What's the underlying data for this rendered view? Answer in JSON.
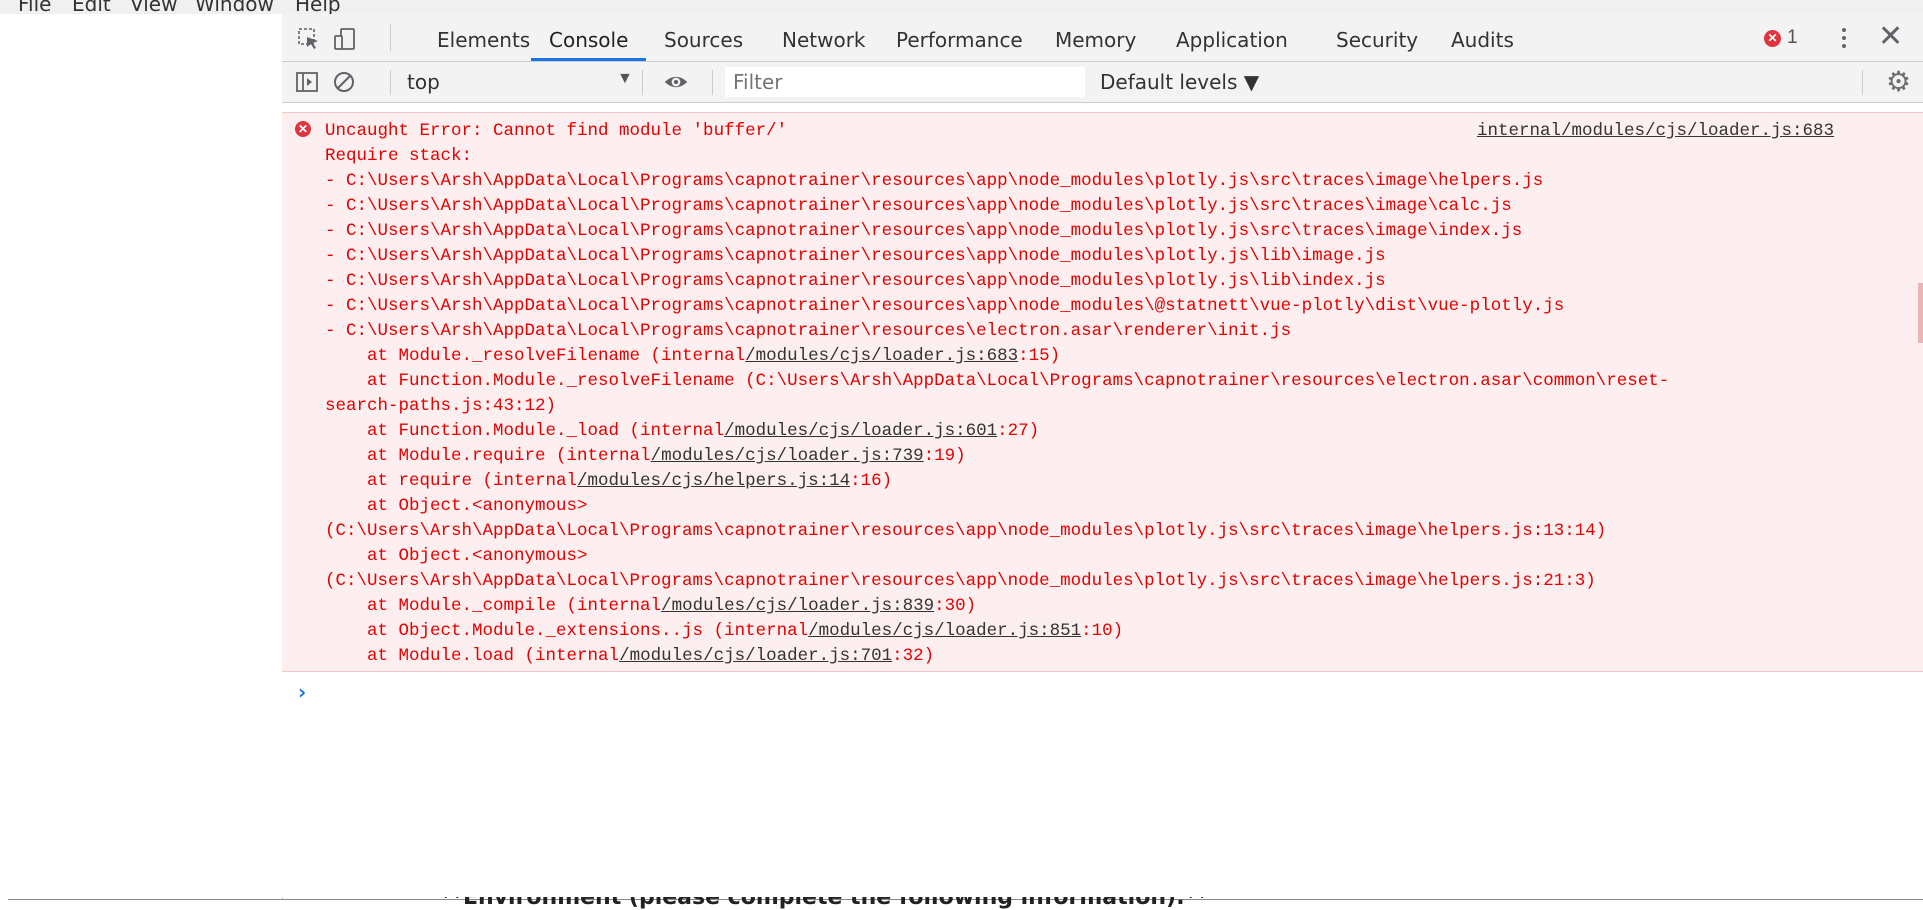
{
  "app_menu": [
    "File",
    "Edit",
    "View",
    "Window",
    "Help"
  ],
  "background_text": "**Environment (please complete the following information):**",
  "devtools": {
    "tabs": [
      "Elements",
      "Console",
      "Sources",
      "Network",
      "Performance",
      "Memory",
      "Application",
      "Security",
      "Audits"
    ],
    "active_tab": "Console",
    "error_count": "1",
    "icons": {
      "inspect": "inspect-element-icon",
      "device": "device-toolbar-icon",
      "menu": "kebab-menu-icon",
      "close": "close-icon",
      "sidebar": "console-sidebar-icon",
      "clear": "clear-console-icon",
      "eye": "live-expression-icon",
      "settings": "gear-icon"
    }
  },
  "console": {
    "context": "top",
    "filter_placeholder": "Filter",
    "levels": "Default levels",
    "accent_color": "#1a73e8",
    "error_color": "#e60000",
    "error_bg": "#fdefef",
    "error": {
      "source_link": "internal/modules/cjs/loader.js:683",
      "lines": [
        [
          {
            "t": "Uncaught Error: Cannot find module 'buffer/'"
          }
        ],
        [
          {
            "t": "Require stack:"
          }
        ],
        [
          {
            "t": "- C:\\Users\\Arsh\\AppData\\Local\\Programs\\capnotrainer\\resources\\app\\node_modules\\plotly.js\\src\\traces\\image\\helpers.js"
          }
        ],
        [
          {
            "t": "- C:\\Users\\Arsh\\AppData\\Local\\Programs\\capnotrainer\\resources\\app\\node_modules\\plotly.js\\src\\traces\\image\\calc.js"
          }
        ],
        [
          {
            "t": "- C:\\Users\\Arsh\\AppData\\Local\\Programs\\capnotrainer\\resources\\app\\node_modules\\plotly.js\\src\\traces\\image\\index.js"
          }
        ],
        [
          {
            "t": "- C:\\Users\\Arsh\\AppData\\Local\\Programs\\capnotrainer\\resources\\app\\node_modules\\plotly.js\\lib\\image.js"
          }
        ],
        [
          {
            "t": "- C:\\Users\\Arsh\\AppData\\Local\\Programs\\capnotrainer\\resources\\app\\node_modules\\plotly.js\\lib\\index.js"
          }
        ],
        [
          {
            "t": "- C:\\Users\\Arsh\\AppData\\Local\\Programs\\capnotrainer\\resources\\app\\node_modules\\@statnett\\vue-plotly\\dist\\vue-plotly.js"
          }
        ],
        [
          {
            "t": "- C:\\Users\\Arsh\\AppData\\Local\\Programs\\capnotrainer\\resources\\electron.asar\\renderer\\init.js"
          }
        ],
        [
          {
            "t": "    at Module._resolveFilename (internal"
          },
          {
            "t": "/modules/cjs/loader.js:683",
            "link": true
          },
          {
            "t": ":15)"
          }
        ],
        [
          {
            "t": "    at Function.Module._resolveFilename (C:\\Users\\Arsh\\AppData\\Local\\Programs\\capnotrainer\\resources\\electron.asar\\common\\reset-"
          }
        ],
        [
          {
            "t": "search-paths.js:43:12)"
          }
        ],
        [
          {
            "t": "    at Function.Module._load (internal"
          },
          {
            "t": "/modules/cjs/loader.js:601",
            "link": true
          },
          {
            "t": ":27)"
          }
        ],
        [
          {
            "t": "    at Module.require (internal"
          },
          {
            "t": "/modules/cjs/loader.js:739",
            "link": true
          },
          {
            "t": ":19)"
          }
        ],
        [
          {
            "t": "    at require (internal"
          },
          {
            "t": "/modules/cjs/helpers.js:14",
            "link": true
          },
          {
            "t": ":16)"
          }
        ],
        [
          {
            "t": "    at Object.<anonymous>"
          }
        ],
        [
          {
            "t": "(C:\\Users\\Arsh\\AppData\\Local\\Programs\\capnotrainer\\resources\\app\\node_modules\\plotly.js\\src\\traces\\image\\helpers.js:13:14)"
          }
        ],
        [
          {
            "t": "    at Object.<anonymous>"
          }
        ],
        [
          {
            "t": "(C:\\Users\\Arsh\\AppData\\Local\\Programs\\capnotrainer\\resources\\app\\node_modules\\plotly.js\\src\\traces\\image\\helpers.js:21:3)"
          }
        ],
        [
          {
            "t": "    at Module._compile (internal"
          },
          {
            "t": "/modules/cjs/loader.js:839",
            "link": true
          },
          {
            "t": ":30)"
          }
        ],
        [
          {
            "t": "    at Object.Module._extensions..js (internal"
          },
          {
            "t": "/modules/cjs/loader.js:851",
            "link": true
          },
          {
            "t": ":10)"
          }
        ],
        [
          {
            "t": "    at Module.load (internal"
          },
          {
            "t": "/modules/cjs/loader.js:701",
            "link": true
          },
          {
            "t": ":32)"
          }
        ]
      ]
    },
    "prompt_symbol": "›"
  }
}
